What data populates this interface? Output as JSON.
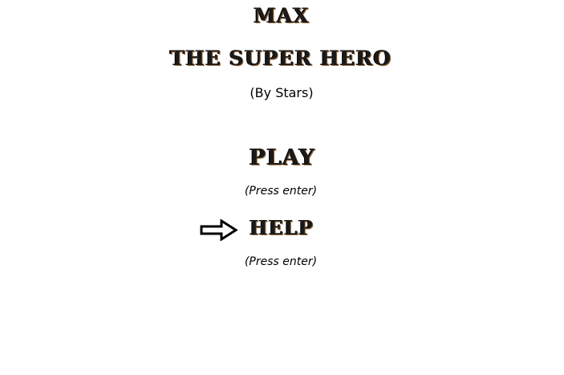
{
  "title": {
    "line1": "MAX",
    "line2": "THE SUPER HERO",
    "byline": "(By Stars)"
  },
  "menu": {
    "items": [
      {
        "label": "PLAY",
        "hint": "(Press enter)"
      },
      {
        "label": "HELP",
        "hint": "(Press enter)"
      }
    ],
    "selected_index": 1,
    "cursor_icon": "arrow-right-icon"
  }
}
